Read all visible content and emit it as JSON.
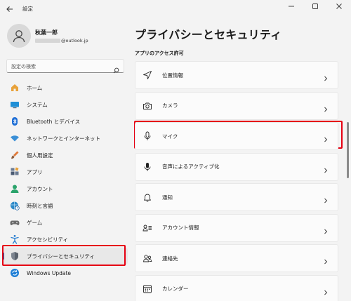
{
  "window": {
    "title": "設定"
  },
  "user": {
    "name": "秋葉一郎",
    "email_suffix": "@outlook.jp"
  },
  "search": {
    "placeholder": "設定の検索"
  },
  "sidebar": {
    "items": [
      {
        "label": "ホーム",
        "icon": "home-icon",
        "color": "#e8a23a"
      },
      {
        "label": "システム",
        "icon": "monitor-icon",
        "color": "#1f8fd6"
      },
      {
        "label": "Bluetooth とデバイス",
        "icon": "bluetooth-icon",
        "color": "#1f6fd6"
      },
      {
        "label": "ネットワークとインターネット",
        "icon": "wifi-icon",
        "color": "#3a8fd6"
      },
      {
        "label": "個人用設定",
        "icon": "brush-icon",
        "color": "#e07a3a"
      },
      {
        "label": "アプリ",
        "icon": "apps-icon",
        "color": "#4a5a72"
      },
      {
        "label": "アカウント",
        "icon": "person-icon",
        "color": "#2aa36b"
      },
      {
        "label": "時刻と言語",
        "icon": "globe-clock-icon",
        "color": "#2a88c8"
      },
      {
        "label": "ゲーム",
        "icon": "gamepad-icon",
        "color": "#6a6a6a"
      },
      {
        "label": "アクセシビリティ",
        "icon": "accessibility-icon",
        "color": "#2a7fd0"
      },
      {
        "label": "プライバシーとセキュリティ",
        "icon": "shield-icon",
        "color": "#6e7680",
        "active": true
      },
      {
        "label": "Windows Update",
        "icon": "update-icon",
        "color": "#1f7fd6"
      }
    ]
  },
  "main": {
    "title": "プライバシーとセキュリティ",
    "section": "アプリのアクセス許可",
    "rows": [
      {
        "label": "位置情報",
        "icon": "location-arrow-icon"
      },
      {
        "label": "カメラ",
        "icon": "camera-icon"
      },
      {
        "label": "マイク",
        "icon": "microphone-icon"
      },
      {
        "label": "音声によるアクティブ化",
        "icon": "voice-activation-icon"
      },
      {
        "label": "通知",
        "icon": "bell-icon"
      },
      {
        "label": "アカウント情報",
        "icon": "account-info-icon"
      },
      {
        "label": "連絡先",
        "icon": "contacts-icon"
      },
      {
        "label": "カレンダー",
        "icon": "calendar-icon"
      }
    ]
  },
  "colors": {
    "accent": "#0067c0",
    "highlight": "#e60012"
  }
}
